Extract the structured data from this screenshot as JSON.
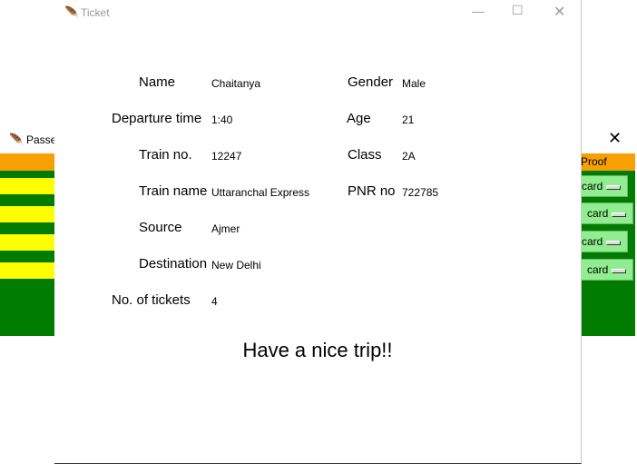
{
  "bg_window": {
    "title": "Passen",
    "close_glyph": "✕",
    "header_right": "Proof",
    "buttons": [
      "card",
      "card",
      "card",
      "card"
    ]
  },
  "ticket_window": {
    "title": "Ticket",
    "close_glyph": "✕",
    "minimize_glyph": "—",
    "maximize_glyph": "☐"
  },
  "ticket": {
    "name_label": "Name",
    "name_value": "Chaitanya",
    "departure_label": "Departure time",
    "departure_value": "1:40",
    "train_no_label": "Train no.",
    "train_no_value": "12247",
    "train_name_label": "Train name",
    "train_name_value": "Uttaranchal Express",
    "source_label": "Source",
    "source_value": "Ajmer",
    "destination_label": "Destination",
    "destination_value": "New Delhi",
    "tickets_label": "No. of tickets",
    "tickets_value": "4",
    "gender_label": "Gender",
    "gender_value": "Male",
    "age_label": "Age",
    "age_value": "21",
    "class_label": "Class",
    "class_value": "2A",
    "pnr_label": "PNR no",
    "pnr_value": "722785",
    "message": "Have a nice trip!!"
  },
  "colors": {
    "header_orange": "#f7a000",
    "body_green": "#007c00",
    "row_yellow": "#ffff00",
    "button_lightgreen": "#90ee90"
  },
  "icons": [
    "feather-icon",
    "close-icon",
    "minimize-icon",
    "maximize-icon"
  ]
}
